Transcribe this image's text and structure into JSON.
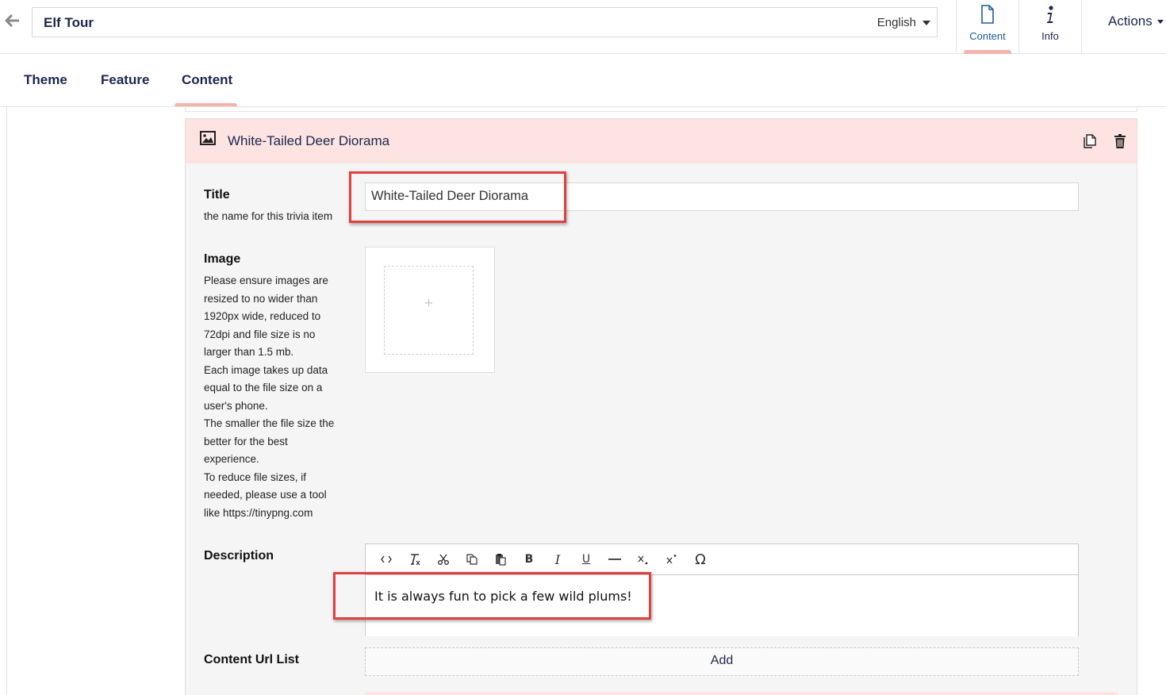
{
  "header": {
    "tour_name": "Elf Tour",
    "language": "English",
    "apps": [
      {
        "label": "Content",
        "icon": "document-icon"
      },
      {
        "label": "Info",
        "icon": "info-icon"
      }
    ],
    "actions_label": "Actions"
  },
  "tabs": [
    {
      "label": "Theme"
    },
    {
      "label": "Feature"
    },
    {
      "label": "Content",
      "active": true
    }
  ],
  "item": {
    "header_title": "White-Tailed Deer Diorama",
    "fields": {
      "title": {
        "label": "Title",
        "help": "the name for this trivia item",
        "value": "White-Tailed Deer Diorama"
      },
      "image": {
        "label": "Image",
        "help_lines": [
          "Please ensure images are",
          "resized to no wider than",
          "1920px wide, reduced to",
          "72dpi and file size is no",
          "larger than 1.5 mb.",
          "Each image takes up data",
          "equal to the file size on a",
          "user's phone.",
          "The smaller the file size the",
          "better for the best",
          "experience.",
          "To reduce file sizes, if",
          "needed, please use a tool",
          "like https://tinypng.com"
        ],
        "placeholder_symbol": "+"
      },
      "description": {
        "label": "Description",
        "value": "It is always fun to pick a few wild plums!",
        "toolbar": [
          "source-code",
          "remove-format",
          "cut",
          "copy",
          "paste",
          "bold",
          "italic",
          "underline",
          "horizontal-line",
          "subscript",
          "superscript",
          "special-character"
        ],
        "toolbar_glyphs": {
          "bold": "B",
          "italic": "I",
          "underline": "U",
          "omega": "Ω"
        }
      },
      "content_url_list": {
        "label": "Content Url List",
        "add_label": "Add"
      }
    }
  },
  "colors": {
    "accent_pink": "#f4b4ae",
    "panel_header": "#fde3e1",
    "navy_text": "#1b264f",
    "highlight_red": "#e04040"
  }
}
